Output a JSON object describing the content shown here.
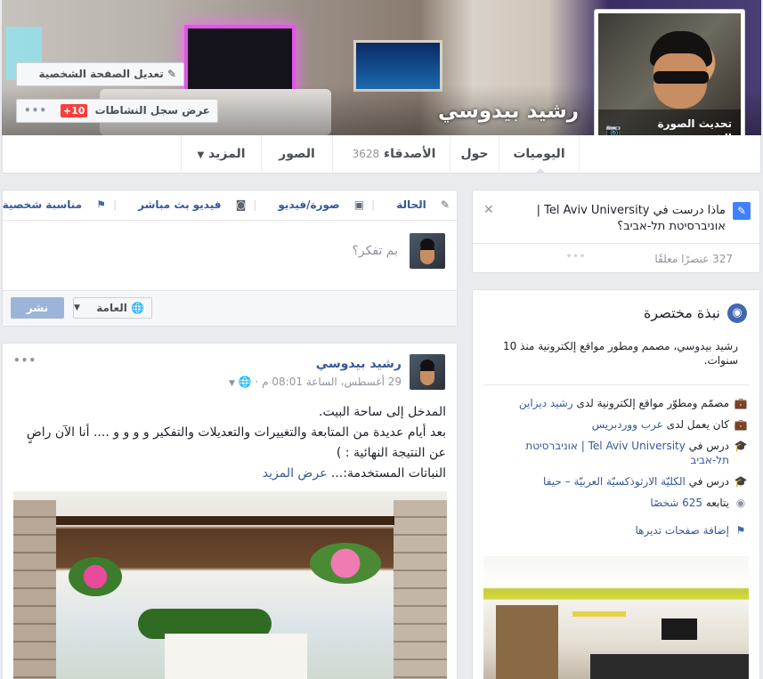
{
  "cover": {
    "name": "رشيد بيدوسي",
    "edit_profile_label": "تعديل الصفحة الشخصية",
    "activity_log_label": "عرض سجل النشاطات",
    "activity_badge": "10+",
    "more_dots": "•••"
  },
  "avatar": {
    "update_label": "تحديث الصورة الشخصية"
  },
  "nav": {
    "timeline": "اليوميات",
    "about": "حول",
    "friends": "الأصدقاء",
    "friends_count": "3628",
    "photos": "الصور",
    "more": "المزيد"
  },
  "composer": {
    "status": "الحالة",
    "photo_video": "صورة/فيديو",
    "live_video": "فيديو بث مباشر",
    "life_event": "مناسبة شخصية",
    "placeholder": "بم تفكر؟",
    "audience": "العامة",
    "post": "نشر"
  },
  "post": {
    "author": "رشيد بيدوسي",
    "date": "29 أغسطس، الساعة 08:01 م",
    "text_line1": "المدخل إلى ساحة البيت.",
    "text_line2": "بعد أيام عديدة من المتابعة والتغييرات والتعديلات والتفكير و و و و .... أنا الآن راضٍ عن النتيجة النهائية : )",
    "text_line3": "النباتات المستخدمة:...",
    "see_more": "عرض المزيد"
  },
  "education_prompt": {
    "question": "ماذا درست في Tel Aviv University | אוניברסיטת תל-אביב؟",
    "pending": "327 عنصرًا معلقًا"
  },
  "intro": {
    "title": "نبذة مختصرة",
    "bio": "رشيد بيدوسي، مصمم ومطور مواقع إلكترونية منذ 10 سنوات.",
    "items": [
      {
        "icon": "briefcase-icon",
        "prefix": "مصمّم ومطوّر مواقع إلكترونية لدى ",
        "link": "رشيد ديزاين"
      },
      {
        "icon": "briefcase-icon",
        "prefix": "كان يعمل لدى ",
        "link": "عرب ووردبريس"
      },
      {
        "icon": "graduation-cap-icon",
        "prefix": "درس في ",
        "link": "Tel Aviv University | אוניברסיטת תל-אביב"
      },
      {
        "icon": "graduation-cap-icon",
        "prefix": "درس في ",
        "link": "الكليّة الارثوذكسيّة العربيّة – حيفا"
      },
      {
        "icon": "rss-icon",
        "prefix": "يتابعه ",
        "link": "625 شخصًا"
      }
    ],
    "add_pages": "إضافة صفحات تديرها"
  }
}
